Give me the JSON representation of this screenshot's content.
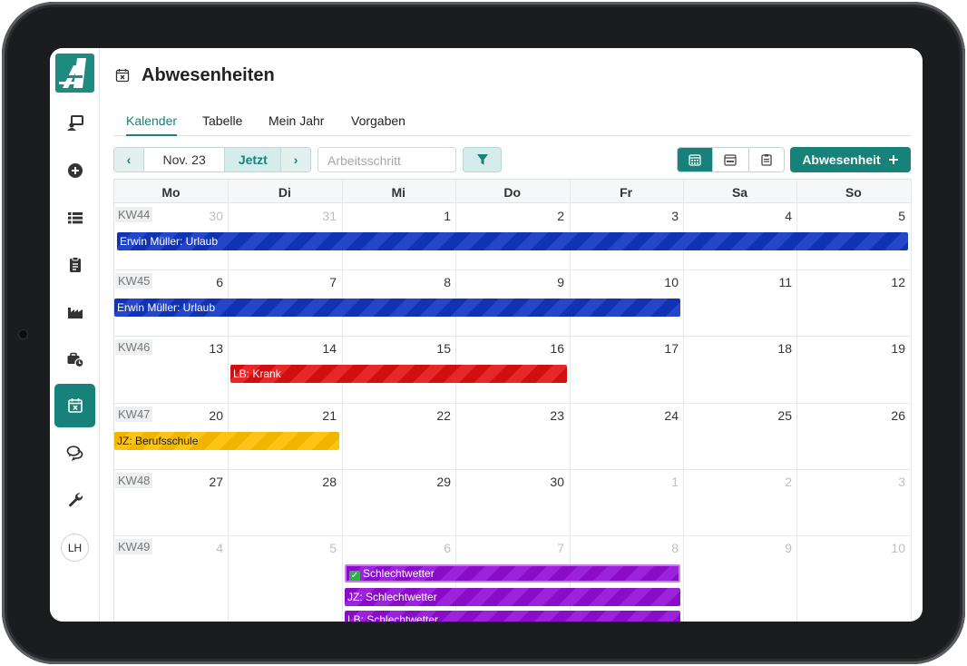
{
  "page": {
    "title": "Abwesenheiten",
    "title_icon": "calendar-x-icon"
  },
  "sidebar": {
    "logo": "company-logo",
    "items": [
      {
        "icon": "presentation-user-icon",
        "active": false
      },
      {
        "icon": "plus-circle-icon",
        "active": false
      },
      {
        "icon": "list-icon",
        "active": false
      },
      {
        "icon": "clipboard-icon",
        "active": false
      },
      {
        "icon": "factory-icon",
        "active": false
      },
      {
        "icon": "briefcase-clock-icon",
        "active": false
      },
      {
        "icon": "calendar-x-icon",
        "active": true
      },
      {
        "icon": "chat-bubbles-icon",
        "active": false
      },
      {
        "icon": "wrench-icon",
        "active": false
      }
    ],
    "avatar_initials": "LH"
  },
  "tabs": [
    {
      "label": "Kalender",
      "active": true
    },
    {
      "label": "Tabelle",
      "active": false
    },
    {
      "label": "Mein Jahr",
      "active": false
    },
    {
      "label": "Vorgaben",
      "active": false
    }
  ],
  "toolbar": {
    "prev_icon": "chevron-left-icon",
    "month_label": "Nov. 23",
    "today_label": "Jetzt",
    "next_icon": "chevron-right-icon",
    "search_placeholder": "Arbeitsschritt",
    "filter_icon": "filter-icon",
    "views": [
      {
        "icon": "calendar-month-icon",
        "active": true
      },
      {
        "icon": "calendar-week-icon",
        "active": false
      },
      {
        "icon": "clipboard-list-icon",
        "active": false
      }
    ],
    "add_label": "Abwesenheit",
    "add_icon": "plus-icon"
  },
  "colors": {
    "accent": "#16827a",
    "urlaub": "#1033b4",
    "krank": "#d10f0f",
    "berufsschule": "#f1b500",
    "schlechtwetter": "#8a0cc9"
  },
  "calendar": {
    "weekdays": [
      "Mo",
      "Di",
      "Mi",
      "Do",
      "Fr",
      "Sa",
      "So"
    ],
    "weeks": [
      {
        "kw": "KW44",
        "days": [
          {
            "n": "30",
            "other": true
          },
          {
            "n": "31",
            "other": true
          },
          {
            "n": "1"
          },
          {
            "n": "2"
          },
          {
            "n": "3"
          },
          {
            "n": "4"
          },
          {
            "n": "5"
          }
        ],
        "events": [
          {
            "label": "Erwin Müller: Urlaub",
            "color": "blue",
            "start": 0,
            "span": 7
          }
        ]
      },
      {
        "kw": "KW45",
        "days": [
          {
            "n": "6"
          },
          {
            "n": "7"
          },
          {
            "n": "8"
          },
          {
            "n": "9"
          },
          {
            "n": "10"
          },
          {
            "n": "11"
          },
          {
            "n": "12"
          }
        ],
        "events": [
          {
            "label": "Erwin Müller: Urlaub",
            "color": "blue",
            "start": 0,
            "span": 5
          }
        ]
      },
      {
        "kw": "KW46",
        "days": [
          {
            "n": "13"
          },
          {
            "n": "14"
          },
          {
            "n": "15"
          },
          {
            "n": "16"
          },
          {
            "n": "17"
          },
          {
            "n": "18"
          },
          {
            "n": "19"
          }
        ],
        "events": [
          {
            "label": "LB: Krank",
            "color": "red",
            "start": 1,
            "span": 3
          }
        ]
      },
      {
        "kw": "KW47",
        "days": [
          {
            "n": "20"
          },
          {
            "n": "21"
          },
          {
            "n": "22"
          },
          {
            "n": "23"
          },
          {
            "n": "24"
          },
          {
            "n": "25"
          },
          {
            "n": "26"
          }
        ],
        "events": [
          {
            "label": "JZ: Berufsschule",
            "color": "yellow",
            "start": 0,
            "span": 2
          }
        ]
      },
      {
        "kw": "KW48",
        "days": [
          {
            "n": "27"
          },
          {
            "n": "28"
          },
          {
            "n": "29"
          },
          {
            "n": "30"
          },
          {
            "n": "1",
            "other": true
          },
          {
            "n": "2",
            "other": true
          },
          {
            "n": "3",
            "other": true
          }
        ],
        "events": []
      },
      {
        "kw": "KW49",
        "days": [
          {
            "n": "4",
            "other": true
          },
          {
            "n": "5",
            "other": true
          },
          {
            "n": "6",
            "other": true
          },
          {
            "n": "7",
            "other": true
          },
          {
            "n": "8",
            "other": true
          },
          {
            "n": "9",
            "other": true
          },
          {
            "n": "10",
            "other": true
          }
        ],
        "events": [
          {
            "label": "Schlechtwetter",
            "color": "purple",
            "start": 2,
            "span": 3,
            "confirmed": true
          },
          {
            "label": "JZ: Schlechtwetter",
            "color": "purple",
            "start": 2,
            "span": 3
          },
          {
            "label": "LB: Schlechtwetter",
            "color": "purple",
            "start": 2,
            "span": 3
          }
        ]
      }
    ]
  }
}
